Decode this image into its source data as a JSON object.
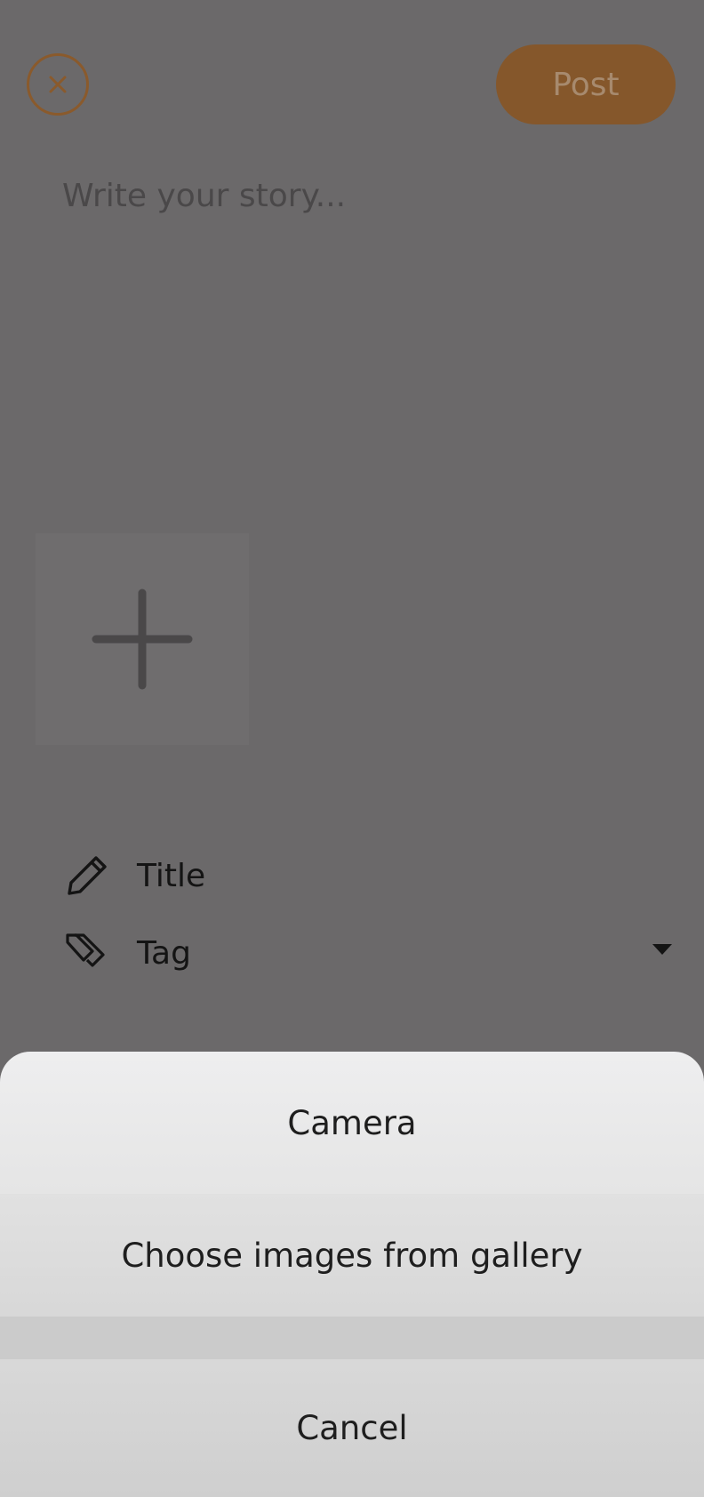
{
  "header": {
    "close_icon": "close-icon",
    "post_label": "Post"
  },
  "editor": {
    "story_placeholder": "Write your story...",
    "add_image_icon": "plus-icon"
  },
  "fields": {
    "title_label": "Title",
    "title_icon": "pencil-icon",
    "tag_label": "Tag",
    "tag_icon": "tag-icon"
  },
  "action_sheet": {
    "camera_label": "Camera",
    "gallery_label": "Choose images from gallery",
    "cancel_label": "Cancel"
  },
  "colors": {
    "overlay_background": "#6b696a",
    "accent": "#85572b",
    "sheet_background": "#e4e4e4"
  }
}
